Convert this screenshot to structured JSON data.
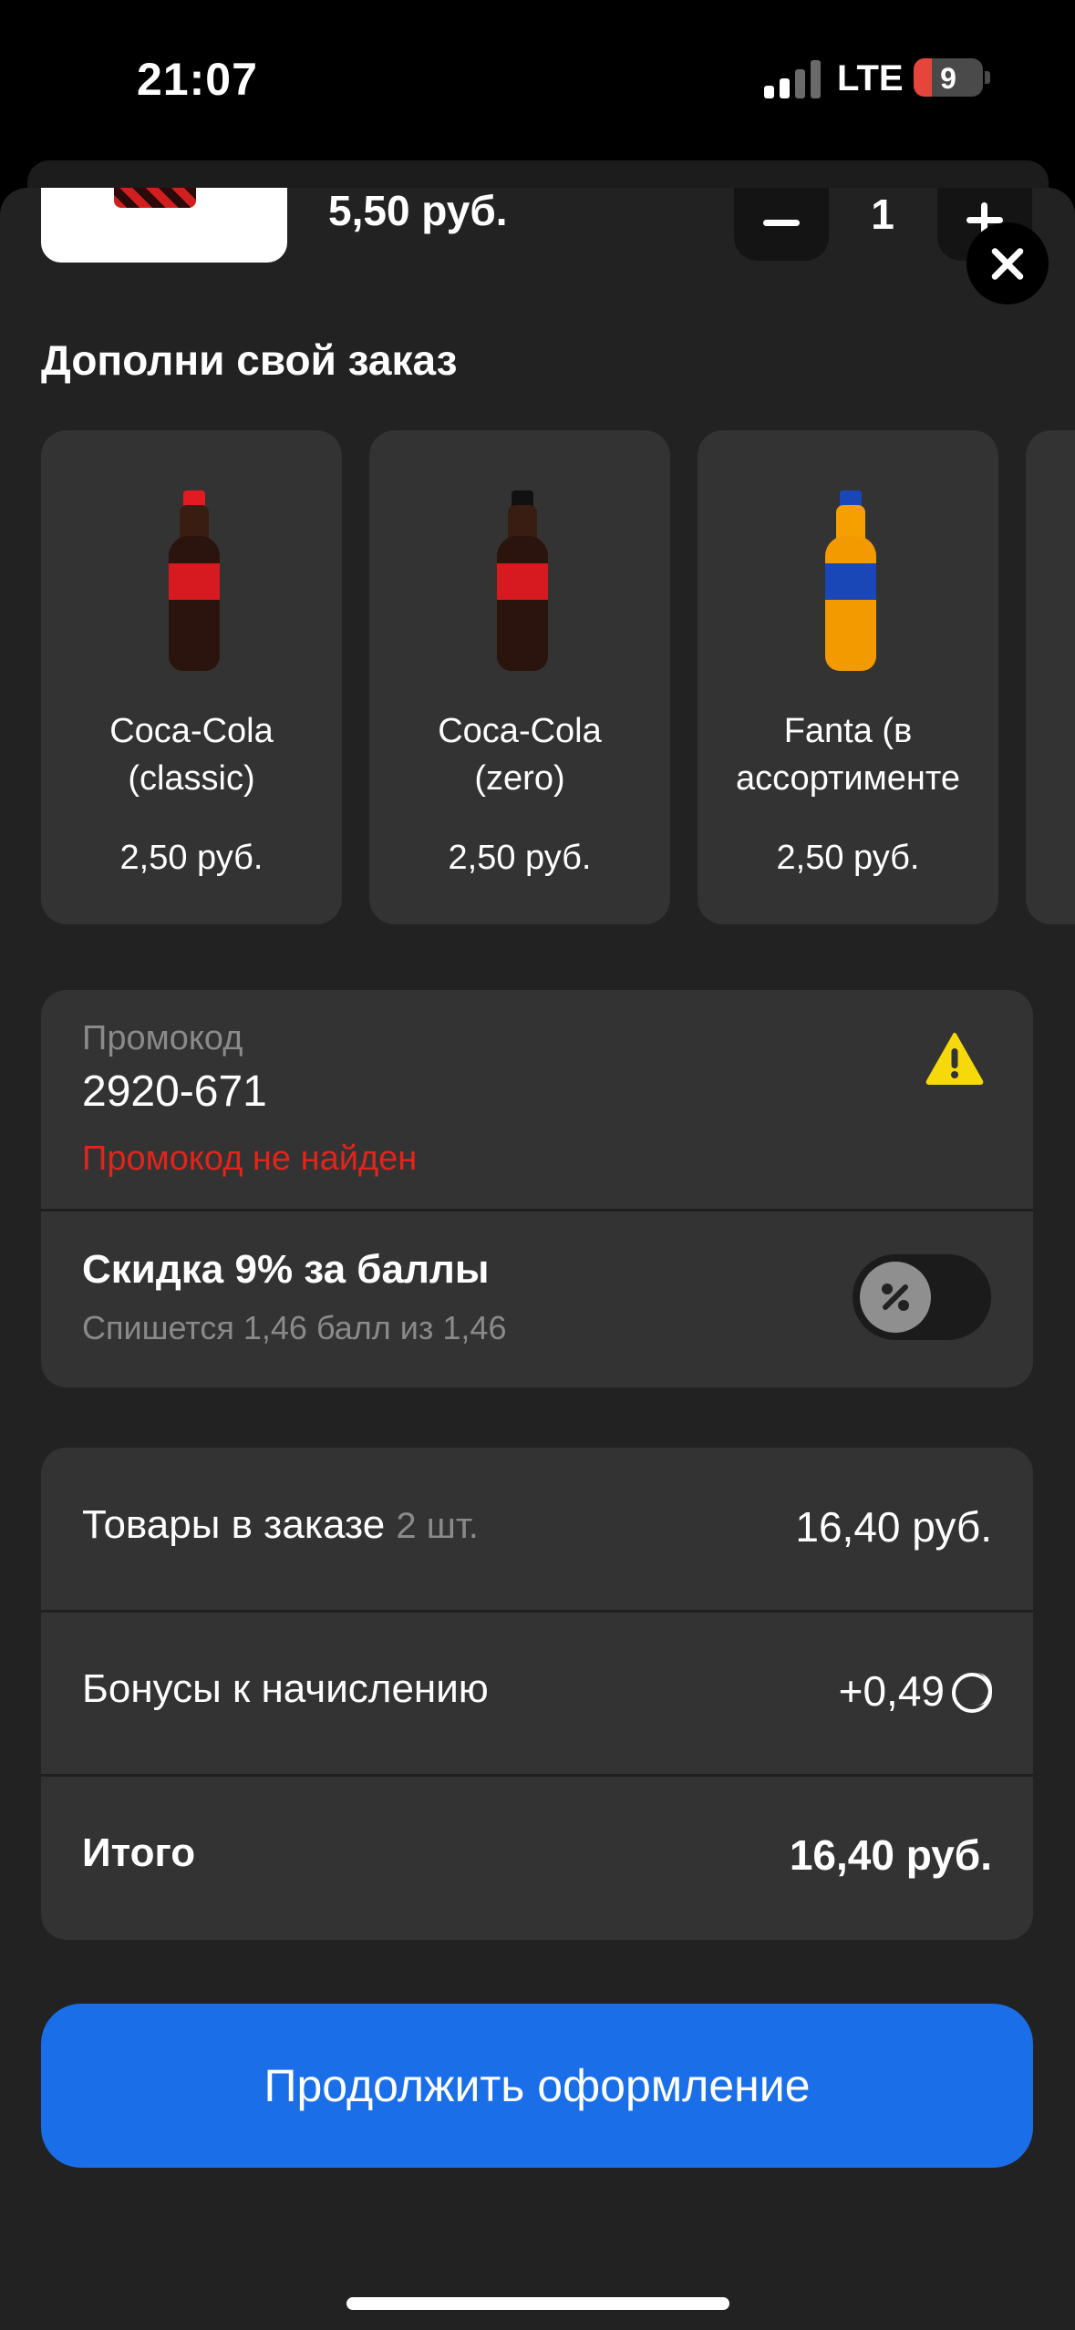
{
  "status_bar": {
    "time": "21:07",
    "network": "LTE",
    "battery_level": "9",
    "battery_color": "#e5453a"
  },
  "cart_item": {
    "price": "5,50 руб.",
    "quantity": "1"
  },
  "upsell": {
    "title": "Дополни свой заказ",
    "items": [
      {
        "name": "Coca-Cola\n(classic)",
        "price": "2,50 руб.",
        "label_color": "#d61a1f",
        "cap_color": "#e21b22"
      },
      {
        "name": "Coca-Cola\n(zero)",
        "price": "2,50 руб.",
        "label_color": "#d61a1f",
        "cap_color": "#111111"
      },
      {
        "name": "Fanta (в\nассортименте",
        "price": "2,50 руб.",
        "label_color": "#1a47b8",
        "cap_color": "#1a47b8"
      }
    ]
  },
  "promo": {
    "label": "Промокод",
    "value": "2920-671",
    "error": "Промокод не найден",
    "warning_color": "#f5d90a",
    "error_color": "#e1251b"
  },
  "discount": {
    "title": "Скидка 9% за баллы",
    "subtitle": "Спишется 1,46 балл из 1,46",
    "toggle_on": false
  },
  "summary": {
    "items_label": "Товары в заказе",
    "items_count": "2 шт.",
    "items_total": "16,40 руб.",
    "bonus_label": "Бонусы к начислению",
    "bonus_value": "+0,49",
    "total_label": "Итого",
    "total_value": "16,40 руб."
  },
  "cta": {
    "label": "Продолжить оформление",
    "color": "#1a6fe8"
  }
}
